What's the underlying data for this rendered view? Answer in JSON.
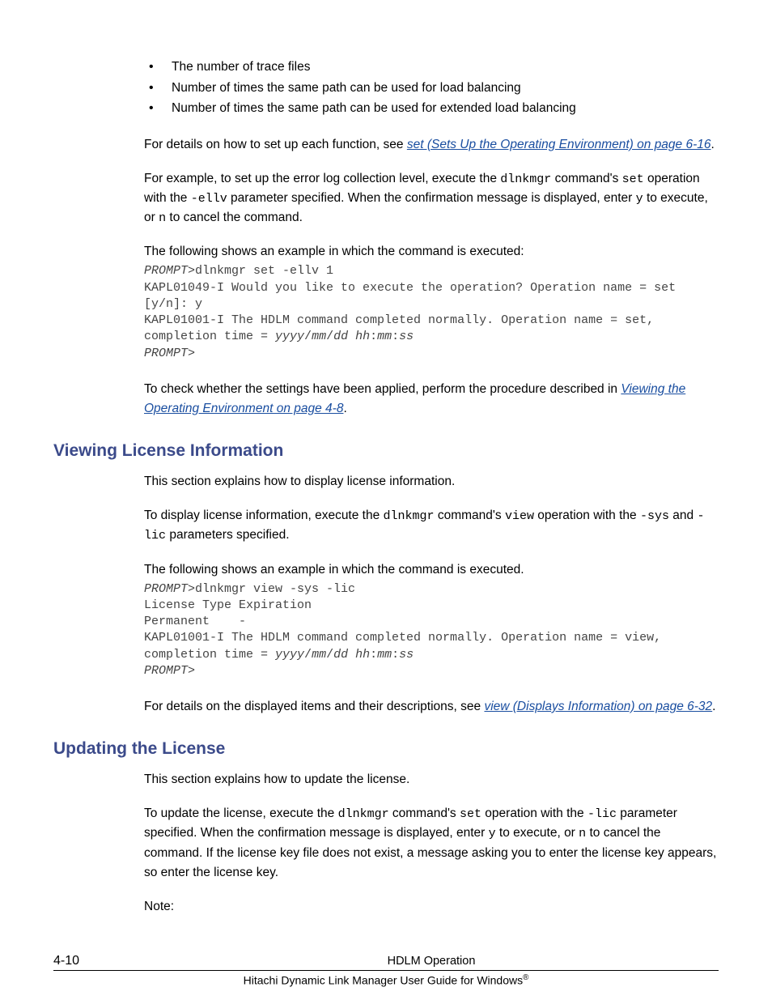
{
  "bullets": {
    "b1": "The number of trace files",
    "b2": "Number of times the same path can be used for load balancing",
    "b3": "Number of times the same path can be used for extended load balancing"
  },
  "para1": {
    "pre": "For details on how to set up each function, see ",
    "link": "set (Sets Up the Operating Environment) on page 6-16",
    "post": "."
  },
  "para2": {
    "t1": "For example, to set up the error log collection level, execute the ",
    "c1": "dlnkmgr",
    "t2": " command's ",
    "c2": "set",
    "t3": " operation with the ",
    "c3": "-ellv",
    "t4": " parameter specified. When the confirmation message is displayed, enter ",
    "c4": "y",
    "t5": " to execute, or ",
    "c5": "n",
    "t6": " to cancel the command."
  },
  "leadin1": "The following shows an example in which the command is executed:",
  "code1": {
    "l1a": "PROMPT",
    "l1b": ">dlnkmgr set -ellv 1",
    "l2": "KAPL01049-I Would you like to execute the operation? Operation name = set [y/n]: y",
    "l3a": "KAPL01001-I The HDLM command completed normally. Operation name = set, completion time = ",
    "l3b": "yyyy",
    "l3c": "/",
    "l3d": "mm",
    "l3e": "/",
    "l3f": "dd hh",
    "l3g": ":",
    "l3h": "mm",
    "l3i": ":",
    "l3j": "ss",
    "l4": "PROMPT",
    "l4b": ">"
  },
  "para3": {
    "pre": "To check whether the settings have been applied, perform the procedure described in ",
    "link": "Viewing the Operating Environment on page 4-8",
    "post": "."
  },
  "heading1": "Viewing License Information",
  "para4": "This section explains how to display license information.",
  "para5": {
    "t1": "To display license information, execute the ",
    "c1": "dlnkmgr",
    "t2": " command's ",
    "c2": "view",
    "t3": " operation with the ",
    "c3": "-sys",
    "t4": " and ",
    "c4": "-lic",
    "t5": " parameters specified."
  },
  "leadin2": "The following shows an example in which the command is executed.",
  "code2": {
    "l1a": "PROMPT",
    "l1b": ">dlnkmgr view -sys -lic",
    "l2": "License Type Expiration",
    "l3": "Permanent    -",
    "l4a": "KAPL01001-I The HDLM command completed normally. Operation name = view, completion time = ",
    "l4b": "yyyy",
    "l4c": "/",
    "l4d": "mm",
    "l4e": "/",
    "l4f": "dd hh",
    "l4g": ":",
    "l4h": "mm",
    "l4i": ":",
    "l4j": "ss",
    "l5": "PROMPT",
    "l5b": ">"
  },
  "para6": {
    "pre": "For details on the displayed items and their descriptions, see ",
    "link": "view (Displays Information) on page 6-32",
    "post": "."
  },
  "heading2": "Updating the License",
  "para7": "This section explains how to update the license.",
  "para8": {
    "t1": "To update the license, execute the ",
    "c1": "dlnkmgr",
    "t2": " command's ",
    "c2": "set",
    "t3": " operation with the ",
    "c3": "-lic",
    "t4": " parameter specified. When the confirmation message is displayed, enter ",
    "c4": "y",
    "t5": " to execute, or ",
    "c5": "n",
    "t6": " to cancel the command. If the license key file does not exist, a message asking you to enter the license key appears, so enter the license key."
  },
  "para9": "Note:",
  "footer": {
    "pagenum": "4-10",
    "title": "HDLM Operation",
    "subtitle_a": "Hitachi Dynamic Link Manager User Guide for Windows",
    "subtitle_b": "®"
  }
}
